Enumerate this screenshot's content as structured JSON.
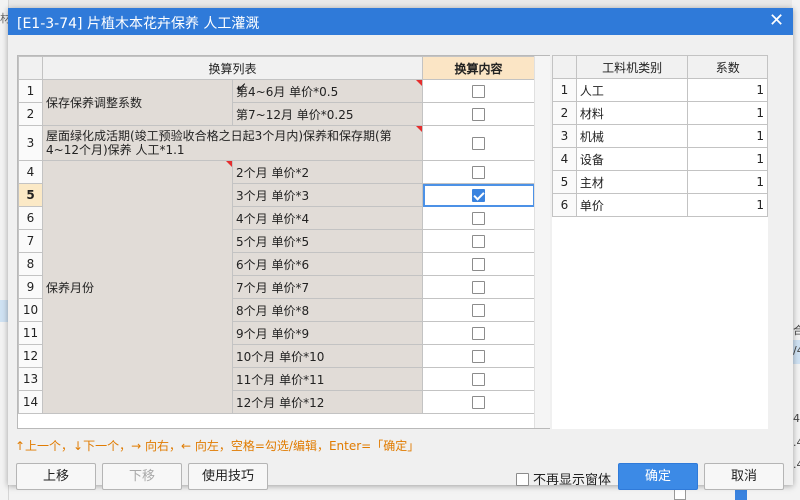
{
  "background": {
    "left_mark": "材",
    "right_marks": [
      "合",
      "/4",
      "4",
      ".4",
      ".4"
    ]
  },
  "dialog": {
    "title": "[E1-3-74] 片植木本花卉保养 人工灌溉",
    "close_glyph": "✕"
  },
  "conversion_table": {
    "header_list": "换算列表",
    "header_content": "换算内容",
    "rows": [
      {
        "n": "1",
        "name": "保存保养调整系数",
        "sub": "第4~6月 单价*0.5",
        "checked": false
      },
      {
        "n": "2",
        "sub": "第7~12月 单价*0.25",
        "checked": false
      },
      {
        "n": "3",
        "name": "屋面绿化成活期(竣工预验收合格之日起3个月内)保养和保存期(第4~12个月)保养 人工*1.1",
        "checked": false
      },
      {
        "n": "4",
        "name": "保养月份",
        "sub": "2个月 单价*2",
        "checked": false
      },
      {
        "n": "5",
        "sub": "3个月 单价*3",
        "checked": true
      },
      {
        "n": "6",
        "sub": "4个月 单价*4",
        "checked": false
      },
      {
        "n": "7",
        "sub": "5个月 单价*5",
        "checked": false
      },
      {
        "n": "8",
        "sub": "6个月 单价*6",
        "checked": false
      },
      {
        "n": "9",
        "sub": "7个月 单价*7",
        "checked": false
      },
      {
        "n": "10",
        "sub": "8个月 单价*8",
        "checked": false
      },
      {
        "n": "11",
        "sub": "9个月 单价*9",
        "checked": false
      },
      {
        "n": "12",
        "sub": "10个月 单价*10",
        "checked": false
      },
      {
        "n": "13",
        "sub": "11个月 单价*11",
        "checked": false
      },
      {
        "n": "14",
        "sub": "12个月 单价*12",
        "checked": false
      }
    ]
  },
  "coef_table": {
    "header_type": "工料机类别",
    "header_coef": "系数",
    "rows": [
      {
        "n": "1",
        "type": "人工",
        "coef": "1"
      },
      {
        "n": "2",
        "type": "材料",
        "coef": "1"
      },
      {
        "n": "3",
        "type": "机械",
        "coef": "1"
      },
      {
        "n": "4",
        "type": "设备",
        "coef": "1"
      },
      {
        "n": "5",
        "type": "主材",
        "coef": "1"
      },
      {
        "n": "6",
        "type": "单价",
        "coef": "1"
      }
    ]
  },
  "hint": "↑上一个，↓下一个，→ 向右，← 向左，空格=勾选/编辑，Enter=「确定」",
  "buttons": {
    "move_up": "上移",
    "move_down": "下移",
    "tips": "使用技巧",
    "no_show": "不再显示窗体",
    "ok": "确定",
    "cancel": "取消"
  },
  "colors": {
    "title_bar": "#2f7ad9",
    "primary_button": "#3c8ae6",
    "hint_text": "#e07b00",
    "gray_cell": "#e1dcd7",
    "active_header": "#fbe5c5"
  }
}
